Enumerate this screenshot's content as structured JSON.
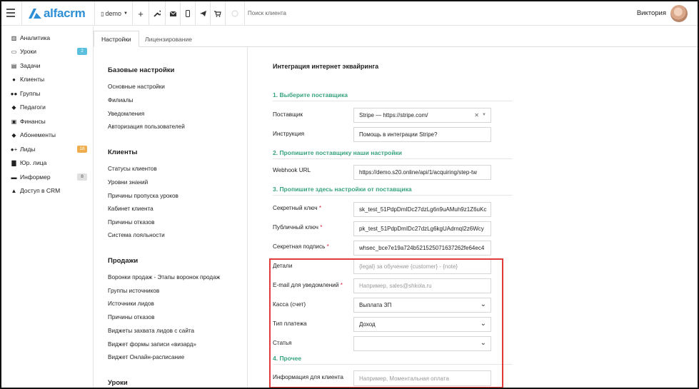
{
  "topbar": {
    "logo": "alfacrm",
    "branch": "demo",
    "search_placeholder": "Поиск клиента",
    "user_name": "Виктория"
  },
  "sidebar": {
    "items": [
      {
        "label": "Аналитика",
        "icon": "analytics-icon",
        "glyph": "▥"
      },
      {
        "label": "Уроки",
        "icon": "calendar-icon",
        "glyph": "▭",
        "badge": "2",
        "badge_color": "#5bc0de"
      },
      {
        "label": "Задачи",
        "icon": "tasks-icon",
        "glyph": "▤"
      },
      {
        "label": "Клиенты",
        "icon": "user-icon",
        "glyph": "●"
      },
      {
        "label": "Группы",
        "icon": "group-icon",
        "glyph": "●●"
      },
      {
        "label": "Педагоги",
        "icon": "graduation-cap-icon",
        "glyph": "◆"
      },
      {
        "label": "Финансы",
        "icon": "money-icon",
        "glyph": "▣"
      },
      {
        "label": "Абонементы",
        "icon": "tag-icon",
        "glyph": "◆"
      },
      {
        "label": "Лиды",
        "icon": "user-plus-icon",
        "glyph": "●+",
        "badge": "18",
        "badge_color": "#f0ad4e"
      },
      {
        "label": "Юр. лица",
        "icon": "building-icon",
        "glyph": "▇"
      },
      {
        "label": "Информер",
        "icon": "inbox-icon",
        "glyph": "▬",
        "badge": "8",
        "badge_color": "#e0e0e0"
      },
      {
        "label": "Доступ в CRM",
        "icon": "lock-icon",
        "glyph": "▲"
      }
    ]
  },
  "tabs": [
    {
      "label": "Настройки"
    },
    {
      "label": "Лицензирование"
    }
  ],
  "settings_nav": {
    "sections": [
      {
        "title": "Базовые настройки",
        "items": [
          "Основные настройки",
          "Филиалы",
          "Уведомления",
          "Авторизация пользователей"
        ]
      },
      {
        "title": "Клиенты",
        "items": [
          "Статусы клиентов",
          "Уровни знаний",
          "Причины пропуска уроков",
          "Кабинет клиента",
          "Причины отказов",
          "Система лояльности"
        ]
      },
      {
        "title": "Продажи",
        "items": [
          "Воронки продаж - Этапы воронок продаж",
          "Группы источников",
          "Источники лидов",
          "Причины отказов",
          "Виджеты захвата лидов с сайта",
          "Виджет формы записи «визард»",
          "Виджет Онлайн-расписание"
        ]
      },
      {
        "title": "Уроки",
        "items": []
      }
    ]
  },
  "main": {
    "title": "Интеграция интернет эквайринга",
    "section1": "1. Выберите поставщика",
    "provider_label": "Поставщик",
    "provider_value": "Stripe — https://stripe.com/",
    "instruction_label": "Инструкция",
    "instruction_value": "Помощь в интеграции Stripe?",
    "section2": "2. Пропишите поставщику наши настройки",
    "webhook_label": "Webhook URL",
    "webhook_value": "https://demo.s20.online/api/1/acquiring/step-tw",
    "section3": "3. Пропишите здесь настройки от поставщика",
    "secret_label": "Секретный ключ",
    "secret_value": "sk_test_51PdpDmIDc27dzLg6n9uAMuh9z1Z6uKc",
    "public_label": "Публичный ключ",
    "public_value": "pk_test_51PdpDmIDc27dzLg6kgUAdrnqI2z6Wcy",
    "signature_label": "Секретная подпись",
    "signature_value": "whsec_bce7e19a724b521525071637262fe64ec4",
    "details_label": "Детали",
    "details_placeholder": "{legal} за обучение {customer} - {note}",
    "email_label": "E-mail для уведомлений",
    "email_placeholder": "Например, sales@shkola.ru",
    "cashbox_label": "Касса (счет)",
    "cashbox_value": "Выплата ЗП",
    "payment_type_label": "Тип платежа",
    "payment_type_value": "Доход",
    "article_label": "Статья",
    "article_value": "",
    "section4": "4. Прочее",
    "client_info_label": "Информация для клиента",
    "client_info_placeholder": "Например, Моментальная оплата",
    "required_mark": "*"
  },
  "colors": {
    "accent_green": "#37a37d",
    "brand_blue": "#2d8fd5",
    "required_red": "#e2293b",
    "highlight_red": "#e23b3b"
  }
}
